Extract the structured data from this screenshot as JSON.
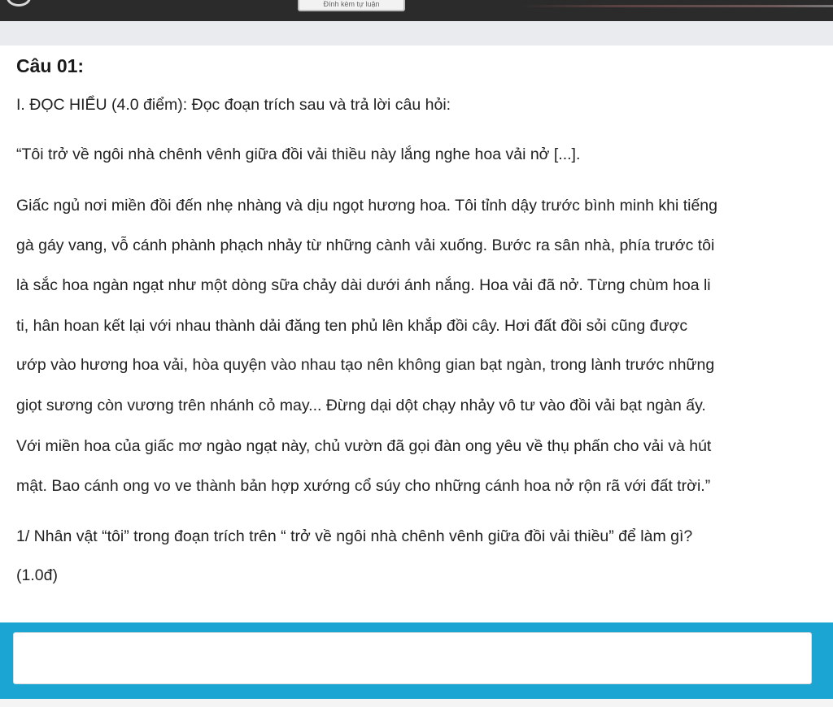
{
  "top_bar": {
    "attach_label": "Đính kèm tự luận"
  },
  "question": {
    "title": "Câu 01:",
    "section_heading": "I. ĐỌC HIỂU (4.0 điểm): Đọc đoạn trích sau và trả lời câu hỏi:",
    "quote_open": "“Tôi trở về ngôi nhà chênh vênh giữa đồi vải thiều này lắng nghe hoa vải nở [...].",
    "passage_lines": [
      "Giấc ngủ nơi miền đồi đến nhẹ nhàng và dịu ngọt hương hoa. Tôi tỉnh dậy trước bình minh khi tiếng",
      "gà gáy vang, vỗ cánh phành phạch nhảy từ những cành vải xuống. Bước ra sân nhà, phía trước tôi",
      "là sắc hoa ngàn ngạt như một dòng sữa chảy dài dưới ánh nắng. Hoa vải đã nở. Từng chùm hoa li",
      "ti, hân hoan kết lại với nhau thành dải đăng ten phủ lên khắp đồi cây. Hơi đất đồi sỏi cũng được",
      "ướp vào hương hoa vải, hòa quyện vào nhau tạo nên không gian bạt ngàn, trong lành trước những",
      "giọt sương còn vương trên nhánh cỏ may... Đừng dại dột chạy nhảy vô tư vào đồi vải bạt ngàn ấy.",
      "Với miền hoa của giấc mơ ngào ngạt này, chủ vườn đã gọi đàn ong yêu về thụ phấn cho vải và hút",
      "mật. Bao cánh ong vo ve thành bản hợp xướng cổ súy cho những cánh hoa nở rộn rã với đất trời.”"
    ],
    "prompt_line_1": "1/ Nhân vật “tôi” trong đoạn trích trên “ trở về ngôi nhà chênh vênh giữa đồi vải thiều” để làm gì?",
    "prompt_line_2": "(1.0đ)"
  },
  "answer": {
    "value": "",
    "placeholder": ""
  }
}
